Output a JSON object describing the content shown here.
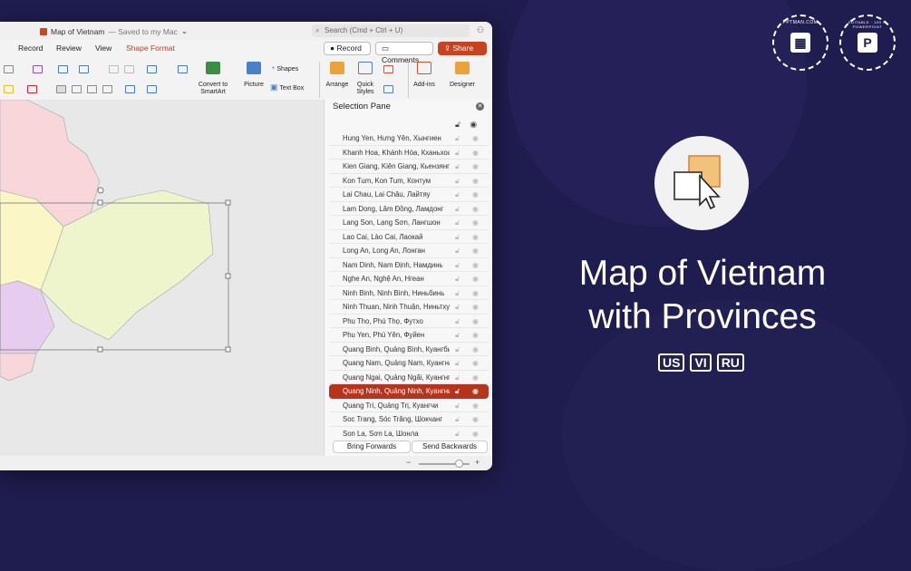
{
  "window": {
    "doc_title": "Map of Vietnam",
    "doc_status": "— Saved to my Mac",
    "search_placeholder": "Search (Cmd + Ctrl + U)"
  },
  "menu": {
    "items": [
      "Record",
      "Review",
      "View",
      "Shape Format"
    ]
  },
  "top_buttons": {
    "record": "Record",
    "comments": "Comments",
    "share": "Share"
  },
  "ribbon": {
    "convert": "Convert to SmartArt",
    "picture": "Picture",
    "shapes": "Shapes",
    "textbox": "Text Box",
    "arrange": "Arrange",
    "quick_styles": "Quick Styles",
    "addins": "Add-ins",
    "designer": "Designer"
  },
  "selection_pane": {
    "title": "Selection Pane",
    "items": [
      "Hung Yen, Hưng Yên, Хынгиен",
      "Khanh Hoa, Khánh Hòa, Кханьхоа",
      "Kien Giang, Kiên Giang, Кьензянг",
      "Kon Tum, Kon Tum, Контум",
      "Lai Chau, Lai Châu, Лайтяу",
      "Lam Dong, Lâm Đồng, Ламдонг",
      "Lang Son, Lạng Sơn, Лангшон",
      "Lao Cai, Lào Cai, Лаокай",
      "Long An, Long An, Лонган",
      "Nam Dinh, Nam Định, Намдинь",
      "Nghe An, Nghệ An, Нгеан",
      "Ninh Binh, Ninh Bình, Ниньбинь",
      "Ninh Thuan, Ninh Thuận, Ниньтхуан",
      "Phu Tho, Phú Thọ, Футхо",
      "Phu Yen, Phú Yên, Фуйен",
      "Quang Binh, Quảng Bình, Куангбинь",
      "Quang Nam, Quảng Nam, Куангнам",
      "Quang Ngai, Quảng Ngãi, Куангнгай",
      "Quang Ninh, Quảng Ninh, Куангнинь",
      "Quang Tri, Quảng Trị, Куангчи",
      "Soc Trang, Sóc Trăng, Шокчанг",
      "Son La, Sơn La, Шонла"
    ],
    "selected_index": 18,
    "bring_forwards": "Bring Forwards",
    "send_backwards": "Send Backwards"
  },
  "hero": {
    "line1": "Map of Vietnam",
    "line2": "with Provinces",
    "languages": [
      "US",
      "VI",
      "RU"
    ]
  },
  "badges": {
    "left_text": "PPTMAN.COM",
    "right_text": "EDITABLE · 100 % POWERPOINT"
  }
}
